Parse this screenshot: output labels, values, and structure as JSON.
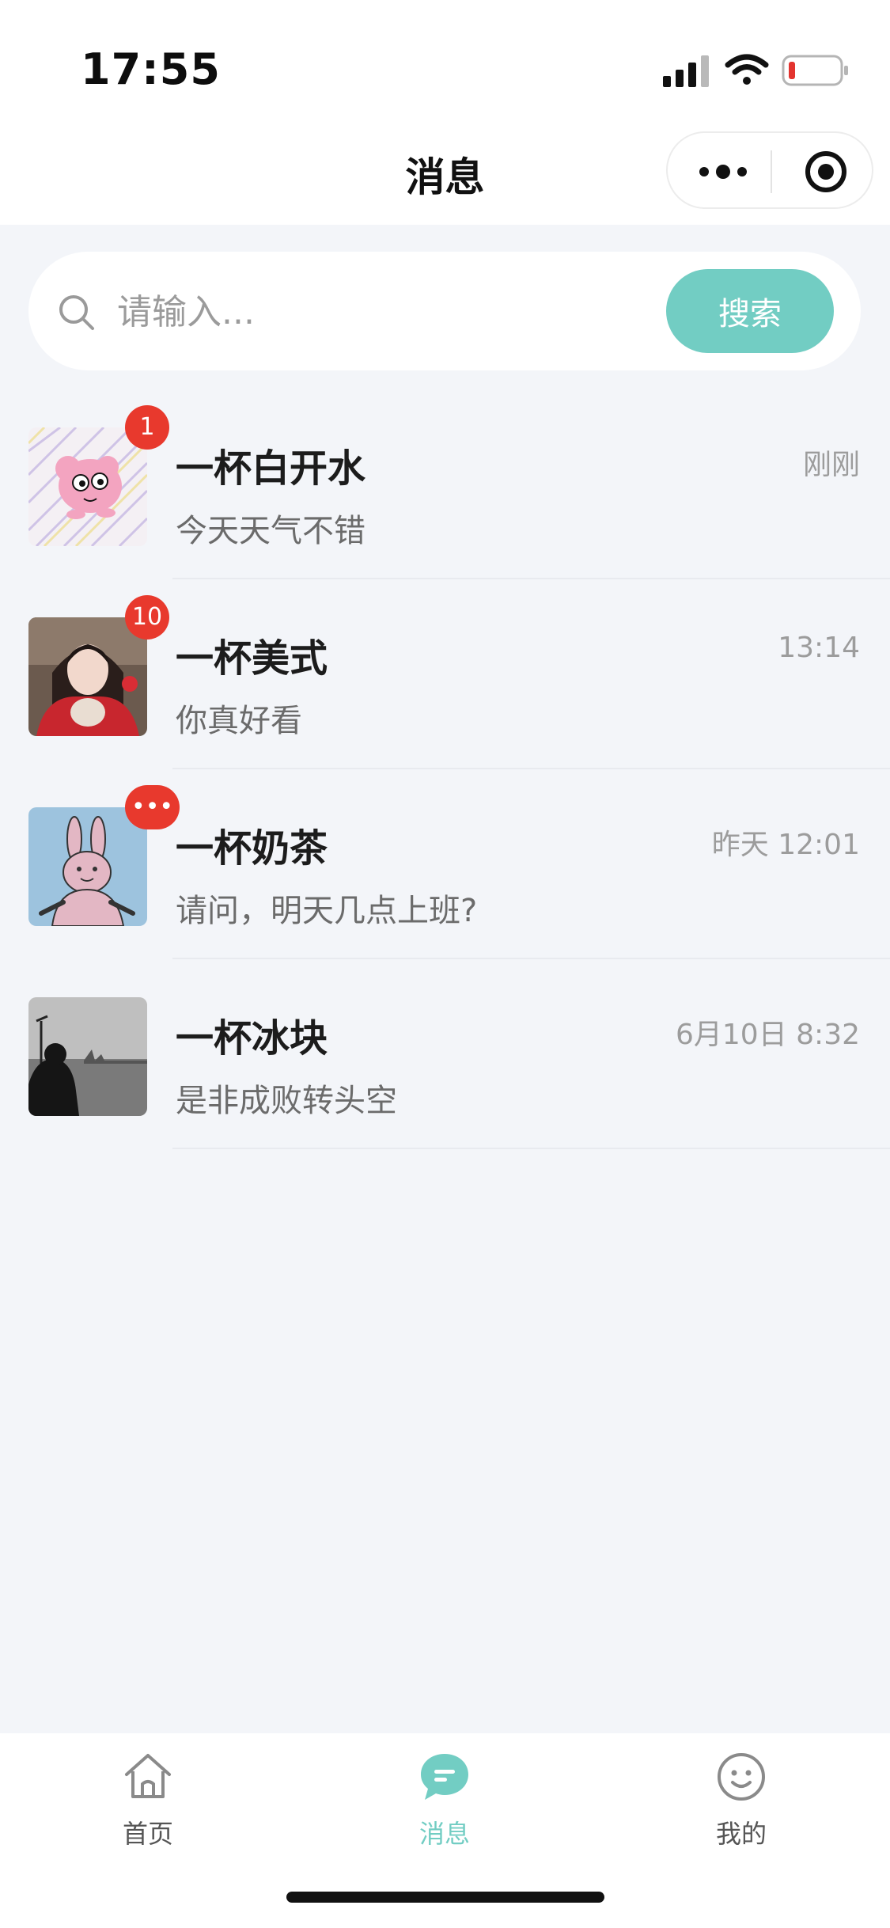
{
  "status_bar": {
    "time": "17:55"
  },
  "nav": {
    "title": "消息"
  },
  "search": {
    "placeholder": "请输入...",
    "button_label": "搜索"
  },
  "conversations": [
    {
      "name": "一杯白开水",
      "time": "刚刚",
      "message": "今天天气不错",
      "badge": "1",
      "avatar": "pink-cartoon"
    },
    {
      "name": "一杯美式",
      "time": "13:14",
      "message": "你真好看",
      "badge": "10",
      "avatar": "girl-photo"
    },
    {
      "name": "一杯奶茶",
      "time": "昨天 12:01",
      "message": "请问，明天几点上班?",
      "badge": "•••",
      "avatar": "rabbit-cartoon"
    },
    {
      "name": "一杯冰块",
      "time": "6月10日 8:32",
      "message": "是非成败转头空",
      "badge": "",
      "avatar": "seaside-bw-photo"
    }
  ],
  "tabbar": {
    "tabs": [
      {
        "label": "首页",
        "icon": "home-icon",
        "active": false
      },
      {
        "label": "消息",
        "icon": "message-icon",
        "active": true
      },
      {
        "label": "我的",
        "icon": "smile-icon",
        "active": false
      }
    ]
  },
  "colors": {
    "accent": "#72cdc3",
    "badge": "#e8392d",
    "background": "#f3f5f9"
  }
}
